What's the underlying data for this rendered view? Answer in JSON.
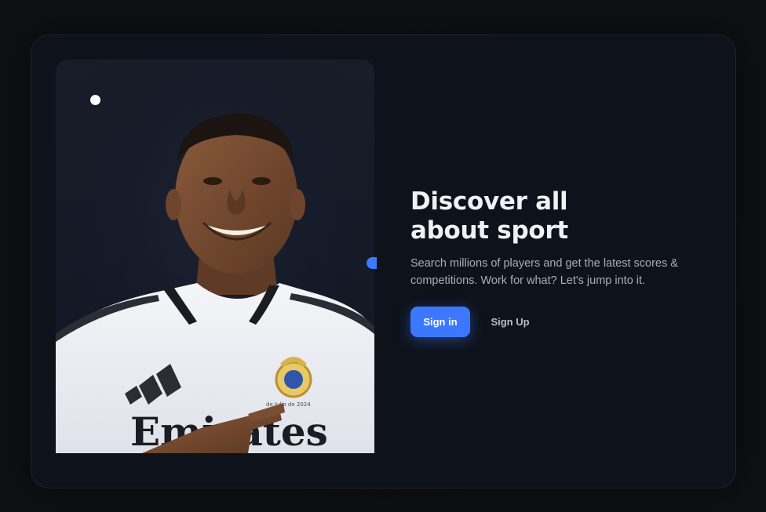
{
  "hero": {
    "image_alt": "Smiling football player in white jersey pointing at club crest",
    "jersey_text": "Emirates",
    "crest_caption": "de Julio de 2024"
  },
  "main": {
    "headline_line1": "Discover all",
    "headline_line2": "about sport",
    "description": "Search millions of players and get the latest scores & competitions. Work for what? Let's jump into it.",
    "signin_label": "Sign in",
    "signup_label": "Sign Up"
  },
  "colors": {
    "accent": "#3b78ff",
    "card_bg": "#0e121a",
    "page_bg": "#101114",
    "heading": "#eef1f6",
    "body_text": "#a8aebb"
  },
  "icons": {
    "top_left_marker": "white-dot",
    "bottom_left_marker": "white-dot",
    "side_marker": "blue-tab"
  }
}
